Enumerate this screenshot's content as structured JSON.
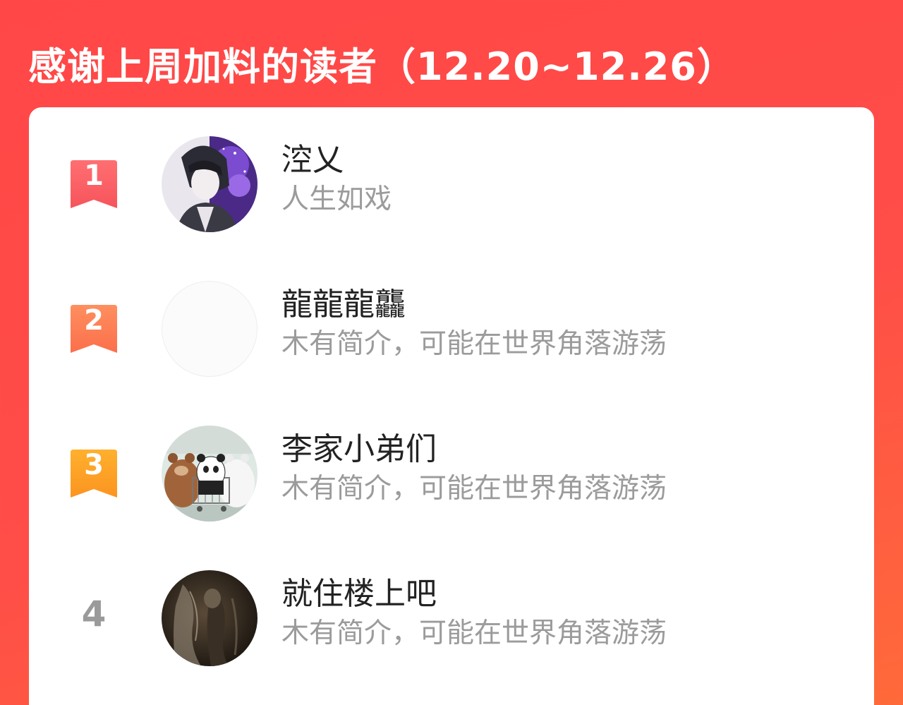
{
  "header": {
    "title": "感谢上周加料的读者（12.20~12.26）"
  },
  "colors": {
    "background": "#ff4848",
    "rank1": "#fb5a5f",
    "rank2": "#fd7a4e",
    "rank3": "#fda028",
    "rank_other": "#9a9a9a"
  },
  "readers": [
    {
      "rank": "1",
      "name": "涳乂",
      "desc": "人生如戏",
      "avatar": "anime-boy-avatar-icon"
    },
    {
      "rank": "2",
      "name": "龍龍龍龘",
      "desc": "木有简介，可能在世界角落游荡",
      "avatar": "blank-avatar"
    },
    {
      "rank": "3",
      "name": "李家小弟们",
      "desc": "木有简介，可能在世界角落游荡",
      "avatar": "bears-avatar-icon"
    },
    {
      "rank": "4",
      "name": "就住楼上吧",
      "desc": "木有简介，可能在世界角落游荡",
      "avatar": "dark-figure-avatar-icon"
    }
  ]
}
